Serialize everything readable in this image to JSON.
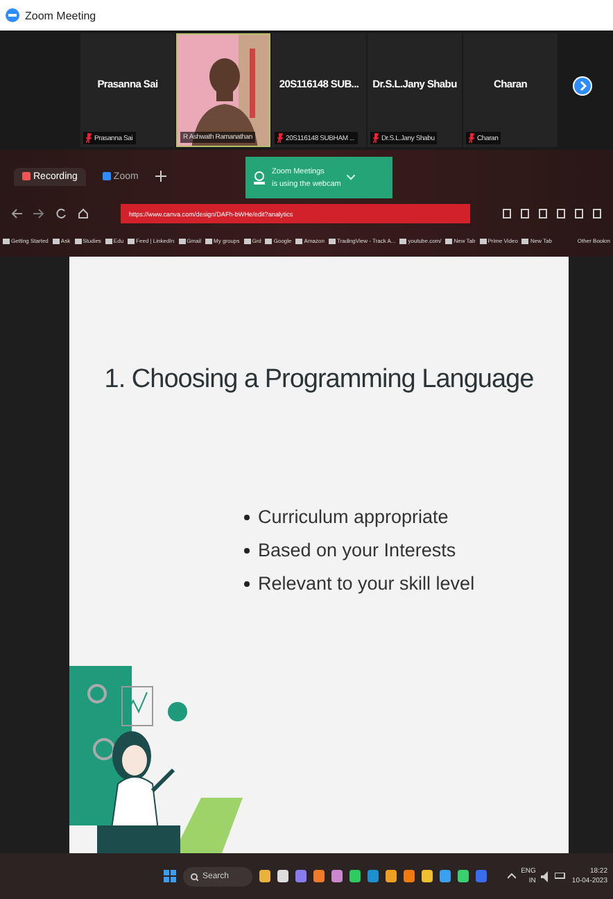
{
  "window": {
    "title": "Zoom Meeting"
  },
  "participants": [
    {
      "kind": "avatar",
      "name": "Prasanna Sai",
      "label": "Prasanna Sai",
      "muted": true
    },
    {
      "kind": "video",
      "label": "R Ashwath Ramanathan",
      "muted": false
    },
    {
      "kind": "avatar",
      "name": "20S116148 SUB...",
      "label": "20S116148 SUBHAM ...",
      "muted": true
    },
    {
      "kind": "avatar",
      "name": "Dr.S.L.Jany Shabu",
      "label": "Dr.S.L.Jany Shabu",
      "muted": true
    },
    {
      "kind": "avatar",
      "name": "Charan",
      "label": "Charan",
      "muted": true
    }
  ],
  "browser": {
    "tabs": [
      {
        "label": "Recording",
        "selected": true
      },
      {
        "label": "Zoom",
        "selected": false
      }
    ],
    "toast": {
      "title": "Zoom Meetings",
      "message": "is using the webcam"
    },
    "url": "https://www.canva.com/design/DAFh-bWHe/edit?analytics",
    "bookmarks": [
      "Getting Started",
      "Ask",
      "Studies",
      "Edu",
      "Feed | LinkedIn",
      "Gmail",
      "My groups",
      "Grd",
      "Google",
      "Amazon",
      "TradingView - Track A...",
      "youtube.com/",
      "New Tab",
      "Prime Video",
      "New Tab"
    ],
    "other_bookmarks": "Other Bookm"
  },
  "slide": {
    "title": "1. Choosing a Programming Language",
    "bullets": [
      "Curriculum appropriate",
      "Based on your Interests",
      "Relevant to your skill level"
    ]
  },
  "taskbar": {
    "search": "Search",
    "language": "ENG",
    "region": "IN",
    "time": "18:22",
    "date": "10-04-2023"
  }
}
